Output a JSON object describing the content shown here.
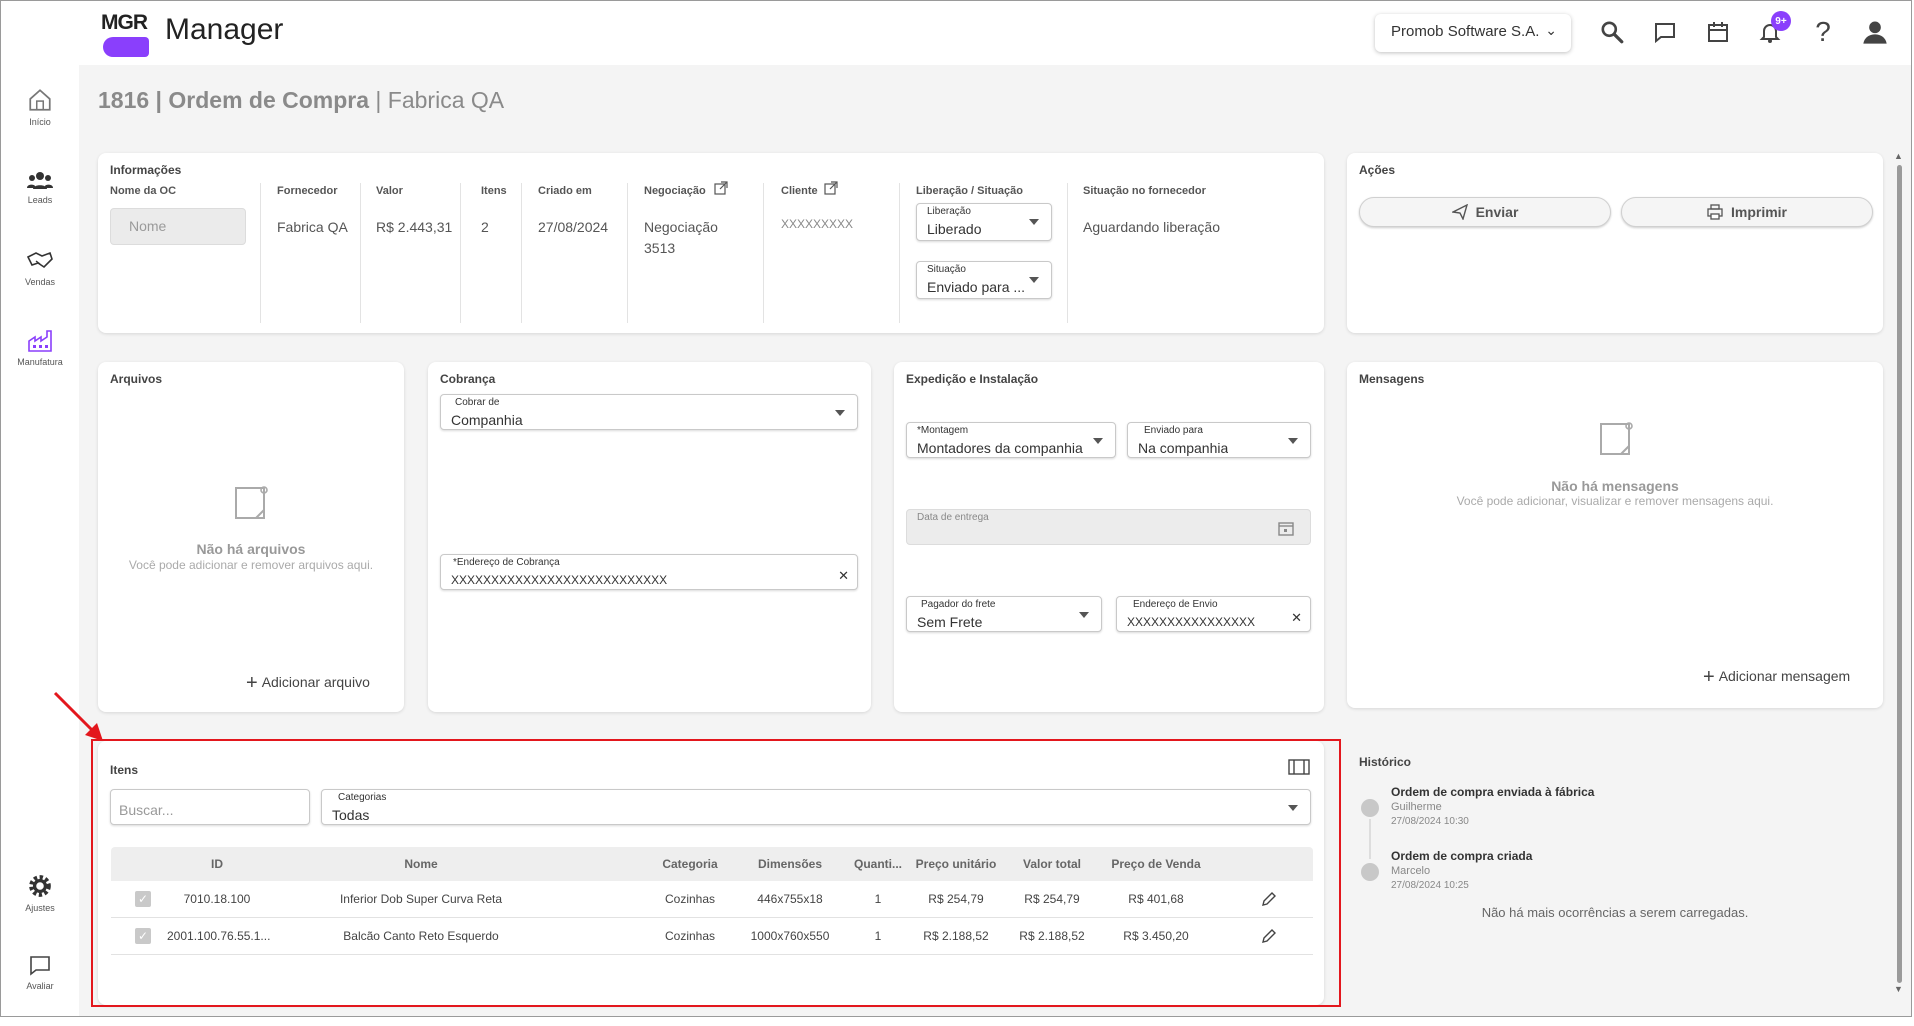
{
  "app": {
    "logo": "MGR",
    "name": "Manager"
  },
  "topbar": {
    "company": "Promob Software S.A.",
    "notifications_badge": "9+"
  },
  "sidebar": {
    "items": [
      {
        "label": "Início",
        "icon": "home-icon"
      },
      {
        "label": "Leads",
        "icon": "people-icon"
      },
      {
        "label": "Vendas",
        "icon": "handshake-icon"
      },
      {
        "label": "Manufatura",
        "icon": "factory-icon"
      },
      {
        "label": "Ajustes",
        "icon": "gear-icon"
      },
      {
        "label": "Avaliar",
        "icon": "chat-icon"
      }
    ]
  },
  "page": {
    "number_title": "1816 | Ordem de Compra",
    "subtitle": " | Fabrica QA"
  },
  "info": {
    "title": "Informações",
    "labels": {
      "name": "Nome da OC",
      "supplier": "Fornecedor",
      "value": "Valor",
      "items": "Itens",
      "created": "Criado em",
      "negotiation": "Negociação",
      "client": "Cliente",
      "release_status": "Liberação / Situação",
      "supplier_status": "Situação no fornecedor"
    },
    "name_placeholder": "Nome",
    "supplier": "Fabrica QA",
    "value": "R$ 2.443,31",
    "items": "2",
    "created": "27/08/2024",
    "negotiation_line1": "Negociação",
    "negotiation_line2": "3513",
    "client": "XXXXXXXXX",
    "release_label": "Liberação",
    "release_value": "Liberado",
    "status_label": "Situação",
    "status_value": "Enviado para ...",
    "supplier_status": "Aguardando liberação"
  },
  "actions": {
    "title": "Ações",
    "send": "Enviar",
    "print": "Imprimir"
  },
  "files": {
    "title": "Arquivos",
    "empty_title": "Não há arquivos",
    "empty_sub": "Você pode adicionar e remover arquivos aqui.",
    "add": "Adicionar arquivo"
  },
  "billing": {
    "title": "Cobrança",
    "charge_label": "Cobrar de",
    "charge_value": "Companhia",
    "address_label": "*Endereço de Cobrança",
    "address_value": "XXXXXXXXXXXXXXXXXXXXXXXXXXX"
  },
  "shipping": {
    "title": "Expedição e Instalação",
    "assembly_label": "*Montagem",
    "assembly_value": "Montadores da companhia",
    "sent_label": "Enviado para",
    "sent_value": "Na companhia",
    "delivery_label": "Data de entrega",
    "freight_label": "Pagador do frete",
    "freight_value": "Sem Frete",
    "ship_address_label": "Endereço de Envio",
    "ship_address_value": "XXXXXXXXXXXXXXXX"
  },
  "messages": {
    "title": "Mensagens",
    "empty_title": "Não há mensagens",
    "empty_sub": "Você pode adicionar, visualizar e remover mensagens aqui.",
    "add": "Adicionar mensagem"
  },
  "items_section": {
    "title": "Itens",
    "search_placeholder": "Buscar...",
    "category_label": "Categorias",
    "category_value": "Todas",
    "columns": [
      "ID",
      "Nome",
      "Categoria",
      "Dimensões",
      "Quanti...",
      "Preço unitário",
      "Valor total",
      "Preço de Venda"
    ],
    "rows": [
      {
        "id": "7010.18.100",
        "name": "Inferior Dob Super Curva Reta",
        "category": "Cozinhas",
        "dims": "446x755x18",
        "qty": "1",
        "unit": "R$ 254,79",
        "total": "R$ 254,79",
        "sale": "R$ 401,68"
      },
      {
        "id": "2001.100.76.55.1...",
        "name": "Balcão Canto Reto Esquerdo",
        "category": "Cozinhas",
        "dims": "1000x760x550",
        "qty": "1",
        "unit": "R$ 2.188,52",
        "total": "R$ 2.188,52",
        "sale": "R$ 3.450,20"
      }
    ]
  },
  "history": {
    "title": "Histórico",
    "events": [
      {
        "title": "Ordem de compra enviada à fábrica",
        "user": "Guilherme",
        "date": "27/08/2024 10:30"
      },
      {
        "title": "Ordem de compra criada",
        "user": "Marcelo",
        "date": "27/08/2024 10:25"
      }
    ],
    "end_text": "Não há mais ocorrências a serem carregadas."
  },
  "colors": {
    "accent": "#8a3ffc",
    "highlight": "#e3171d"
  }
}
